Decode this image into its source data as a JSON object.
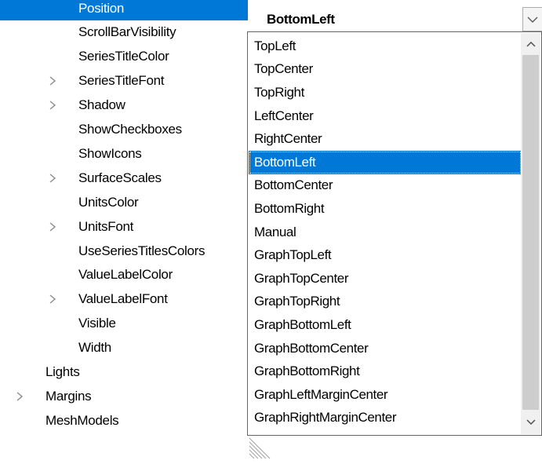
{
  "property_grid": {
    "rows": [
      {
        "label": "Position",
        "expandable": false,
        "selected": true,
        "indent": 1
      },
      {
        "label": "ScrollBarVisibility",
        "expandable": false,
        "selected": false,
        "indent": 1
      },
      {
        "label": "SeriesTitleColor",
        "expandable": false,
        "selected": false,
        "indent": 1
      },
      {
        "label": "SeriesTitleFont",
        "expandable": true,
        "selected": false,
        "indent": 1
      },
      {
        "label": "Shadow",
        "expandable": true,
        "selected": false,
        "indent": 1
      },
      {
        "label": "ShowCheckboxes",
        "expandable": false,
        "selected": false,
        "indent": 1
      },
      {
        "label": "ShowIcons",
        "expandable": false,
        "selected": false,
        "indent": 1
      },
      {
        "label": "SurfaceScales",
        "expandable": true,
        "selected": false,
        "indent": 1
      },
      {
        "label": "UnitsColor",
        "expandable": false,
        "selected": false,
        "indent": 1
      },
      {
        "label": "UnitsFont",
        "expandable": true,
        "selected": false,
        "indent": 1
      },
      {
        "label": "UseSeriesTitlesColors",
        "expandable": false,
        "selected": false,
        "indent": 1
      },
      {
        "label": "ValueLabelColor",
        "expandable": false,
        "selected": false,
        "indent": 1
      },
      {
        "label": "ValueLabelFont",
        "expandable": true,
        "selected": false,
        "indent": 1
      },
      {
        "label": "Visible",
        "expandable": false,
        "selected": false,
        "indent": 1
      },
      {
        "label": "Width",
        "expandable": false,
        "selected": false,
        "indent": 1
      },
      {
        "label": "Lights",
        "expandable": false,
        "selected": false,
        "indent": 0
      },
      {
        "label": "Margins",
        "expandable": true,
        "selected": false,
        "indent": 0
      },
      {
        "label": "MeshModels",
        "expandable": false,
        "selected": false,
        "indent": 0
      }
    ]
  },
  "value_editor": {
    "current_value": "BottomLeft",
    "dropdown_icon": "chevron-down-icon"
  },
  "dropdown": {
    "options": [
      "TopLeft",
      "TopCenter",
      "TopRight",
      "LeftCenter",
      "RightCenter",
      "BottomLeft",
      "BottomCenter",
      "BottomRight",
      "Manual",
      "GraphTopLeft",
      "GraphTopCenter",
      "GraphTopRight",
      "GraphBottomLeft",
      "GraphBottomCenter",
      "GraphBottomRight",
      "GraphLeftMarginCenter",
      "GraphRightMarginCenter"
    ],
    "selected_index": 5,
    "scrollbar": {
      "up_icon": "chevron-up-icon",
      "down_icon": "chevron-down-icon"
    },
    "resize_grip_icon": "resize-grip-icon"
  },
  "colors": {
    "selection": "#0078d7",
    "chevron": "#8a8a8a",
    "scrollbar_track": "#f0f0f0",
    "scrollbar_thumb": "#cdcdcd"
  }
}
